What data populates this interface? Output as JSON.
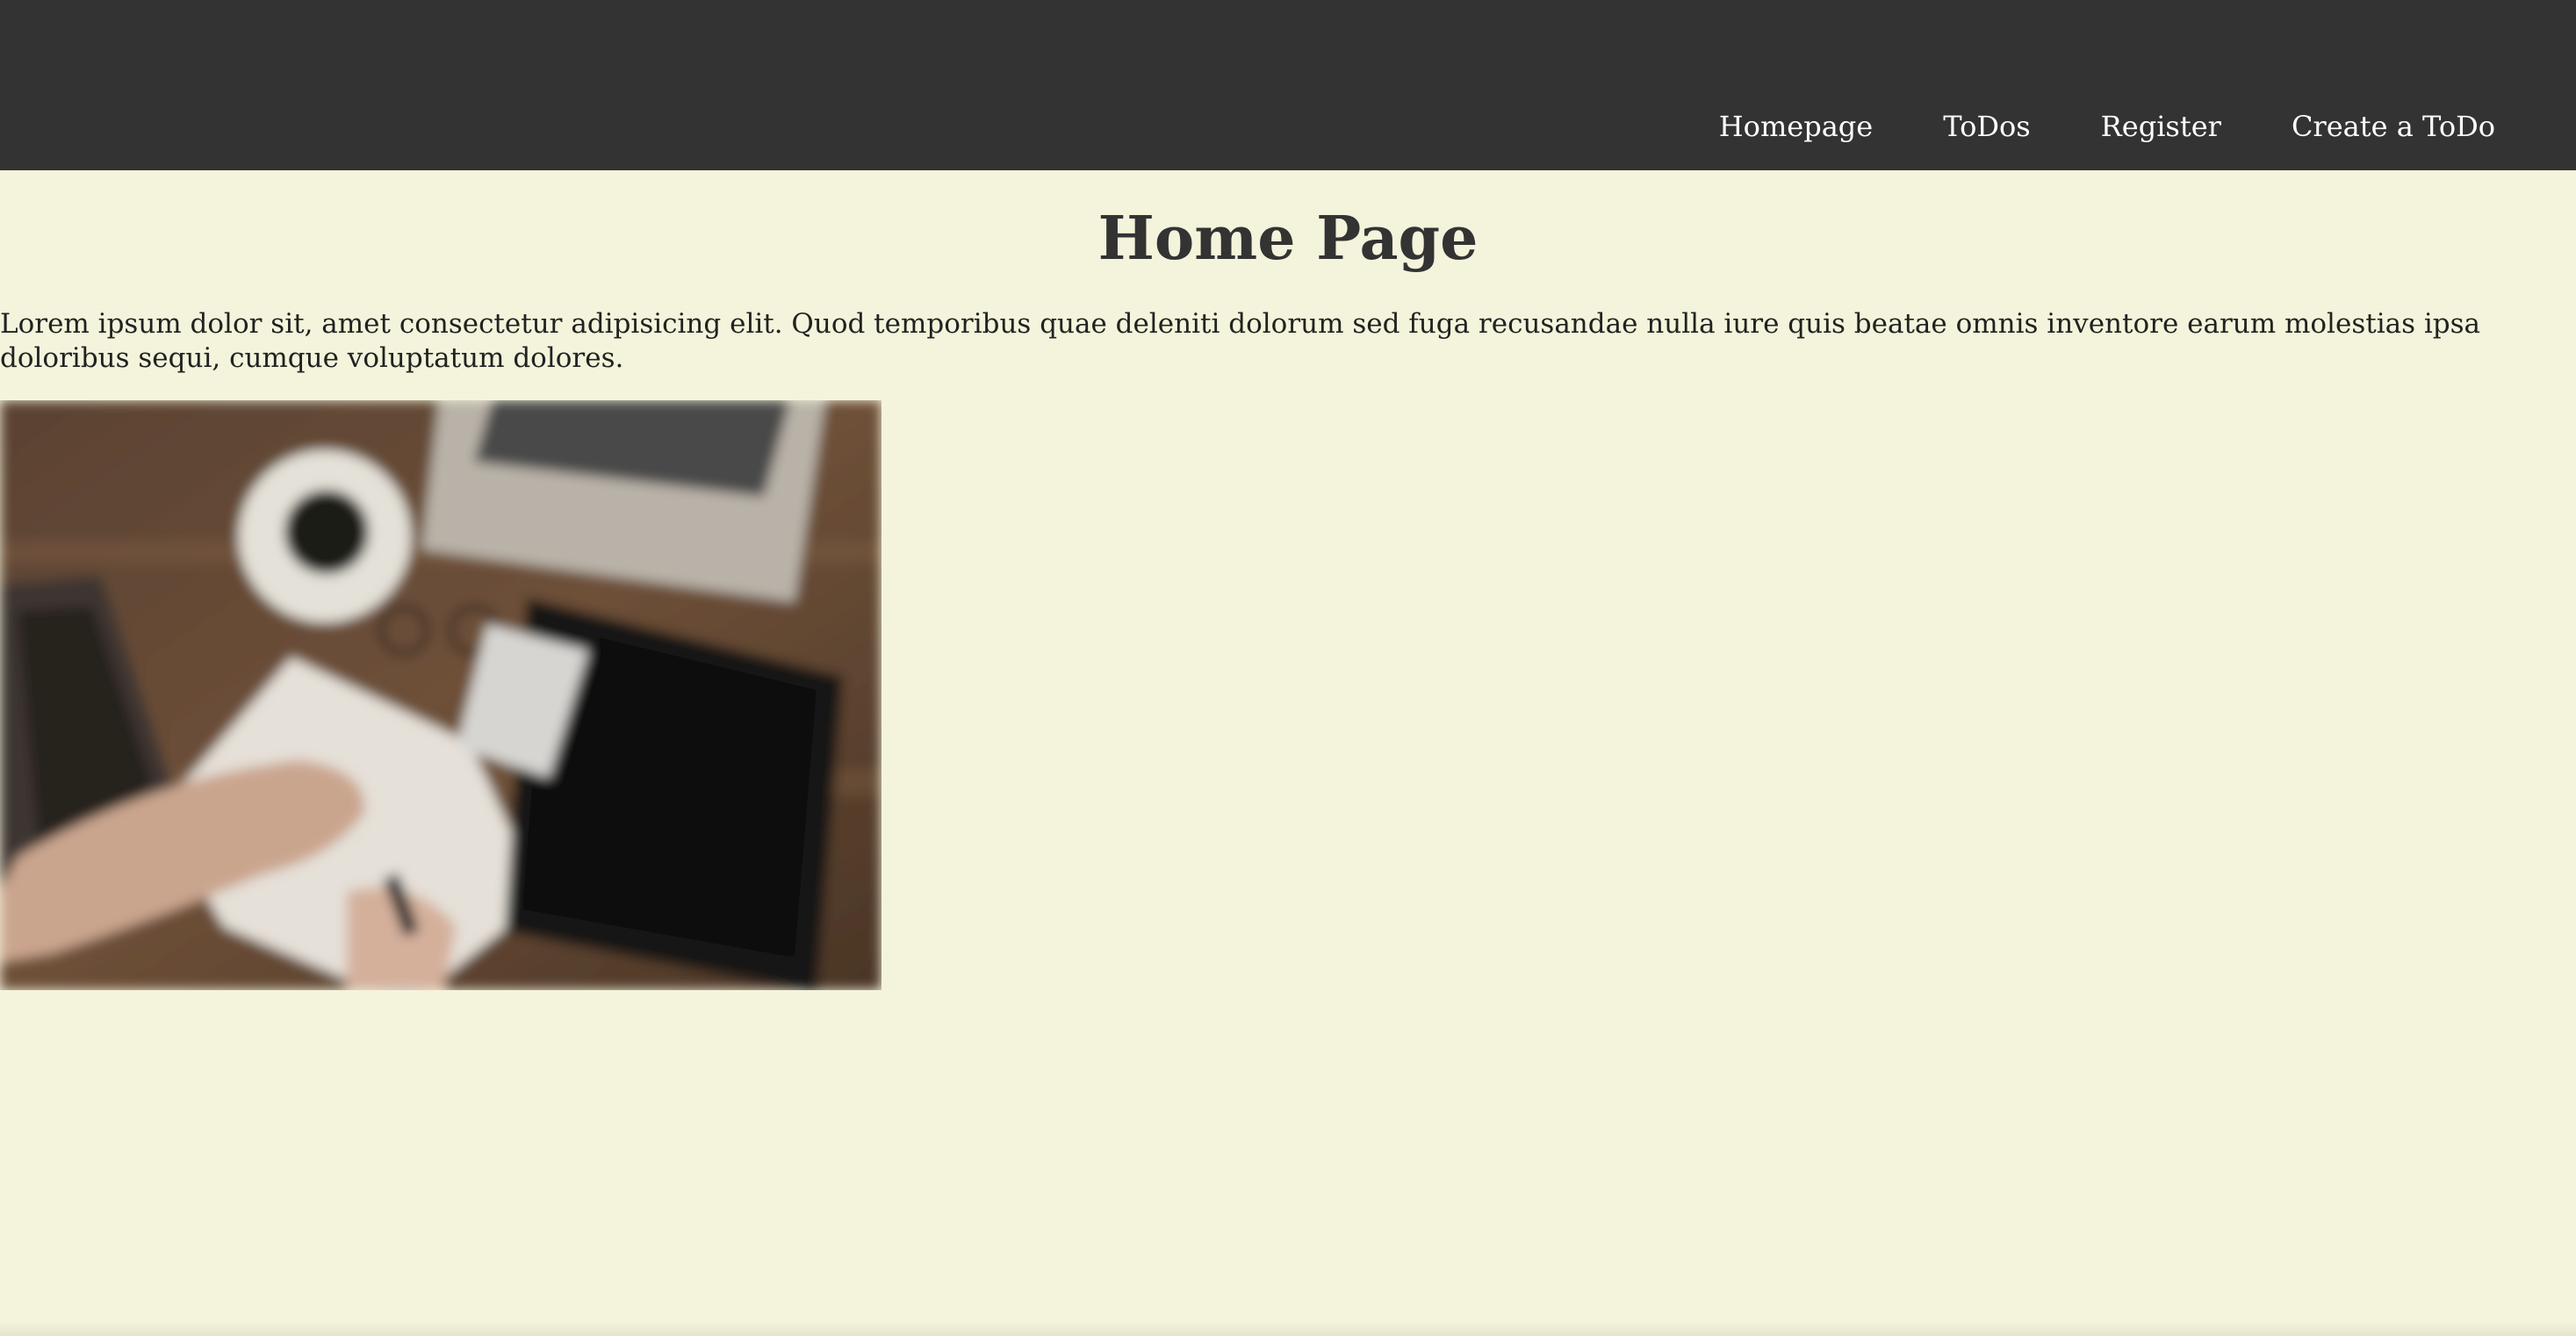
{
  "navbar": {
    "background": "#333333",
    "links": [
      {
        "label": "Homepage"
      },
      {
        "label": "ToDos"
      },
      {
        "label": "Register"
      },
      {
        "label": "Create a ToDo"
      }
    ]
  },
  "main": {
    "title": "Home Page",
    "intro": "Lorem ipsum dolor sit, amet consectetur adipisicing elit. Quod temporibus quae deleniti dolorum sed fuga recusandae nulla iure quis beatae omnis inventore earum molestias ipsa doloribus sequi, cumque voluptatum dolores.",
    "image": {
      "subject": "desk with coffee cup, laptop, notebook, tablet and hand writing"
    }
  },
  "colors": {
    "page_background": "#f4f4dc",
    "title_text": "#333333",
    "nav_text": "#ffffff"
  }
}
